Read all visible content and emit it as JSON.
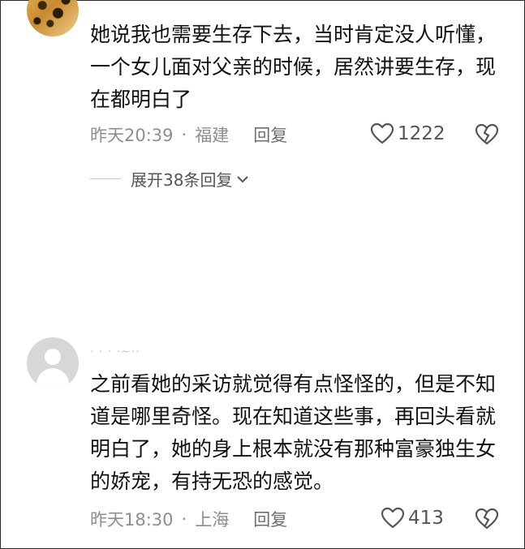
{
  "comments": [
    {
      "username": "",
      "text": "她说我也需要生存下去，当时肯定没人听懂，一个女儿面对父亲的时候，居然讲要生存，现在都明白了",
      "time": "昨天20:39",
      "location": "福建",
      "reply_label": "回复",
      "likes": "1222",
      "expand_label": "展开38条回复"
    },
    {
      "username": "· · · ·~··",
      "text": "之前看她的采访就觉得有点怪怪的，但是不知道是哪里奇怪。现在知道这些事，再回头看就明白了，她的身上根本就没有那种富豪独生女的娇宠，有持无恐的感觉。",
      "time": "昨天18:30",
      "location": "上海",
      "reply_label": "回复",
      "likes": "413"
    }
  ],
  "separator": "·",
  "icons": {
    "like": "heart-outline-icon",
    "dislike": "broken-heart-icon",
    "expand": "chevron-down-icon"
  },
  "colors": {
    "text": "#111111",
    "meta": "#8e8e8e"
  }
}
